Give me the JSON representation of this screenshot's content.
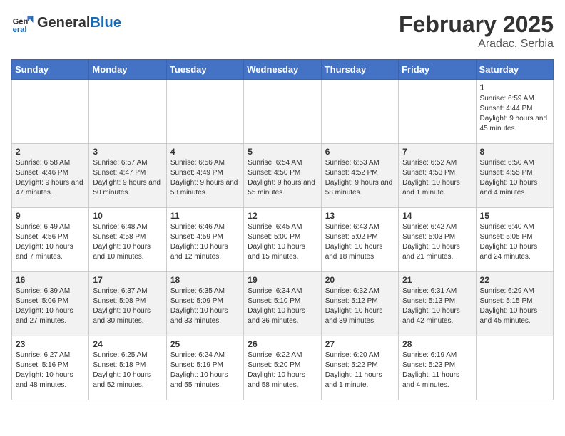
{
  "header": {
    "logo_general": "General",
    "logo_blue": "Blue",
    "month_year": "February 2025",
    "location": "Aradac, Serbia"
  },
  "days_of_week": [
    "Sunday",
    "Monday",
    "Tuesday",
    "Wednesday",
    "Thursday",
    "Friday",
    "Saturday"
  ],
  "weeks": [
    [
      {
        "day": "",
        "info": ""
      },
      {
        "day": "",
        "info": ""
      },
      {
        "day": "",
        "info": ""
      },
      {
        "day": "",
        "info": ""
      },
      {
        "day": "",
        "info": ""
      },
      {
        "day": "",
        "info": ""
      },
      {
        "day": "1",
        "info": "Sunrise: 6:59 AM\nSunset: 4:44 PM\nDaylight: 9 hours and 45 minutes."
      }
    ],
    [
      {
        "day": "2",
        "info": "Sunrise: 6:58 AM\nSunset: 4:46 PM\nDaylight: 9 hours and 47 minutes."
      },
      {
        "day": "3",
        "info": "Sunrise: 6:57 AM\nSunset: 4:47 PM\nDaylight: 9 hours and 50 minutes."
      },
      {
        "day": "4",
        "info": "Sunrise: 6:56 AM\nSunset: 4:49 PM\nDaylight: 9 hours and 53 minutes."
      },
      {
        "day": "5",
        "info": "Sunrise: 6:54 AM\nSunset: 4:50 PM\nDaylight: 9 hours and 55 minutes."
      },
      {
        "day": "6",
        "info": "Sunrise: 6:53 AM\nSunset: 4:52 PM\nDaylight: 9 hours and 58 minutes."
      },
      {
        "day": "7",
        "info": "Sunrise: 6:52 AM\nSunset: 4:53 PM\nDaylight: 10 hours and 1 minute."
      },
      {
        "day": "8",
        "info": "Sunrise: 6:50 AM\nSunset: 4:55 PM\nDaylight: 10 hours and 4 minutes."
      }
    ],
    [
      {
        "day": "9",
        "info": "Sunrise: 6:49 AM\nSunset: 4:56 PM\nDaylight: 10 hours and 7 minutes."
      },
      {
        "day": "10",
        "info": "Sunrise: 6:48 AM\nSunset: 4:58 PM\nDaylight: 10 hours and 10 minutes."
      },
      {
        "day": "11",
        "info": "Sunrise: 6:46 AM\nSunset: 4:59 PM\nDaylight: 10 hours and 12 minutes."
      },
      {
        "day": "12",
        "info": "Sunrise: 6:45 AM\nSunset: 5:00 PM\nDaylight: 10 hours and 15 minutes."
      },
      {
        "day": "13",
        "info": "Sunrise: 6:43 AM\nSunset: 5:02 PM\nDaylight: 10 hours and 18 minutes."
      },
      {
        "day": "14",
        "info": "Sunrise: 6:42 AM\nSunset: 5:03 PM\nDaylight: 10 hours and 21 minutes."
      },
      {
        "day": "15",
        "info": "Sunrise: 6:40 AM\nSunset: 5:05 PM\nDaylight: 10 hours and 24 minutes."
      }
    ],
    [
      {
        "day": "16",
        "info": "Sunrise: 6:39 AM\nSunset: 5:06 PM\nDaylight: 10 hours and 27 minutes."
      },
      {
        "day": "17",
        "info": "Sunrise: 6:37 AM\nSunset: 5:08 PM\nDaylight: 10 hours and 30 minutes."
      },
      {
        "day": "18",
        "info": "Sunrise: 6:35 AM\nSunset: 5:09 PM\nDaylight: 10 hours and 33 minutes."
      },
      {
        "day": "19",
        "info": "Sunrise: 6:34 AM\nSunset: 5:10 PM\nDaylight: 10 hours and 36 minutes."
      },
      {
        "day": "20",
        "info": "Sunrise: 6:32 AM\nSunset: 5:12 PM\nDaylight: 10 hours and 39 minutes."
      },
      {
        "day": "21",
        "info": "Sunrise: 6:31 AM\nSunset: 5:13 PM\nDaylight: 10 hours and 42 minutes."
      },
      {
        "day": "22",
        "info": "Sunrise: 6:29 AM\nSunset: 5:15 PM\nDaylight: 10 hours and 45 minutes."
      }
    ],
    [
      {
        "day": "23",
        "info": "Sunrise: 6:27 AM\nSunset: 5:16 PM\nDaylight: 10 hours and 48 minutes."
      },
      {
        "day": "24",
        "info": "Sunrise: 6:25 AM\nSunset: 5:18 PM\nDaylight: 10 hours and 52 minutes."
      },
      {
        "day": "25",
        "info": "Sunrise: 6:24 AM\nSunset: 5:19 PM\nDaylight: 10 hours and 55 minutes."
      },
      {
        "day": "26",
        "info": "Sunrise: 6:22 AM\nSunset: 5:20 PM\nDaylight: 10 hours and 58 minutes."
      },
      {
        "day": "27",
        "info": "Sunrise: 6:20 AM\nSunset: 5:22 PM\nDaylight: 11 hours and 1 minute."
      },
      {
        "day": "28",
        "info": "Sunrise: 6:19 AM\nSunset: 5:23 PM\nDaylight: 11 hours and 4 minutes."
      },
      {
        "day": "",
        "info": ""
      }
    ]
  ]
}
